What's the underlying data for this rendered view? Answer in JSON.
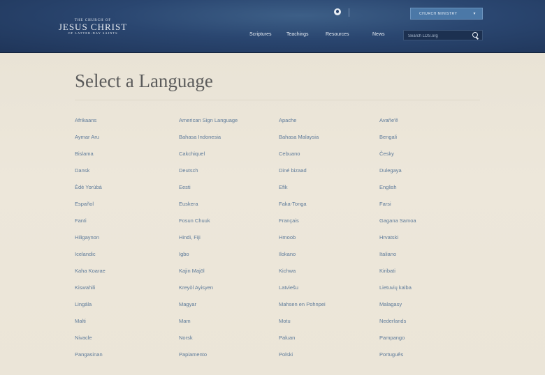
{
  "header": {
    "logo": {
      "line1": "THE CHURCH OF",
      "line2": "JESUS CHRIST",
      "line3": "OF LATTER-DAY SAINTS"
    },
    "ministry_button": "CHURCH MINISTRY",
    "nav": [
      "Scriptures",
      "Teachings",
      "Resources",
      "News"
    ],
    "search": {
      "placeholder": "Search LDS.org"
    }
  },
  "main": {
    "title": "Select a Language",
    "columns": [
      [
        "Afrikaans",
        "Aymar Aru",
        "Bislama",
        "Dansk",
        "Èdè Yorùbá",
        "Español",
        "Fanti",
        "Hiligaynon",
        "Icelandic",
        "Kaha Koarae",
        "Kiswahili",
        "Lingála",
        "Malti",
        "Nivacle",
        "Pangasinan"
      ],
      [
        "American Sign Language",
        "Bahasa Indonesia",
        "Cakchiquel",
        "Deutsch",
        "Eesti",
        "Euskera",
        "Fosun Chuuk",
        "Hindi, Fiji",
        "Igbo",
        "Kajin Majōl",
        "Kreyòl Ayisyen",
        "Magyar",
        "Mam",
        "Norsk",
        "Papiamento"
      ],
      [
        "Apache",
        "Bahasa Malaysia",
        "Cebuano",
        "Diné bizaad",
        "Efik",
        "Faka-Tonga",
        "Français",
        "Hmoob",
        "Ilokano",
        "Kichwa",
        "Latviešu",
        "Mahsen en Pohnpei",
        "Motu",
        "Paluan",
        "Polski"
      ],
      [
        "Avañe'ẽ",
        "Bengali",
        "Česky",
        "Dulegaya",
        "English",
        "Farsi",
        "Gagana Samoa",
        "Hrvatski",
        "Italiano",
        "Kiribati",
        "Lietuvių kalba",
        "Malagasy",
        "Nederlands",
        "Pampango",
        "Português"
      ]
    ]
  }
}
